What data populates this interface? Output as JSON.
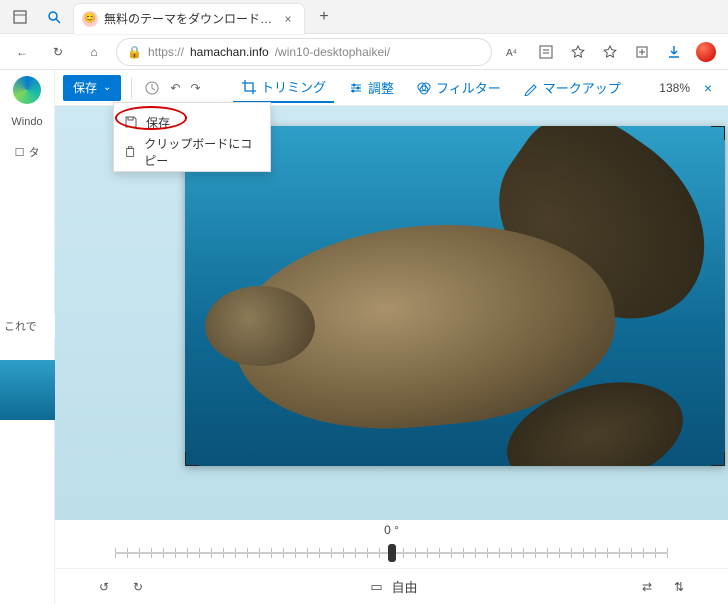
{
  "tab": {
    "title": "無料のテーマをダウンロードして壁紙",
    "close_glyph": "×"
  },
  "newtab_glyph": "+",
  "url": {
    "protocol": "https://",
    "host": "hamachan.info",
    "path": "/win10-desktophaikei/"
  },
  "nav": {
    "back": "←",
    "refresh": "↻",
    "home": "⌂",
    "lock": "🔒"
  },
  "right_icons": [
    "A⁴",
    "read",
    "star-plus",
    "star",
    "collections",
    "download"
  ],
  "sidebar": {
    "windows_label": "Windo",
    "row_icon": "☐",
    "row_text": "タ"
  },
  "page_text": "これで",
  "toolbar": {
    "save_label": "保存",
    "chevron": "⌄",
    "undo": "↶",
    "redo": "↷",
    "reset": "↺",
    "tools": [
      {
        "id": "trim",
        "label": "トリミング",
        "active": true
      },
      {
        "id": "adjust",
        "label": "調整",
        "active": false
      },
      {
        "id": "filter",
        "label": "フィルター",
        "active": false
      },
      {
        "id": "markup",
        "label": "マークアップ",
        "active": false
      }
    ],
    "zoom": "138%",
    "close": "×"
  },
  "dropdown": {
    "items": [
      {
        "id": "save",
        "label": "保存"
      },
      {
        "id": "copy",
        "label": "クリップボードにコピー"
      }
    ]
  },
  "rotation": {
    "angle_label": "0 °"
  },
  "bottombar": {
    "rotate_ccw": "↺",
    "rotate_cw": "↻",
    "aspect_icon": "▭",
    "aspect_label": "自由",
    "flip_h": "⇄",
    "flip_v": "⇅"
  }
}
